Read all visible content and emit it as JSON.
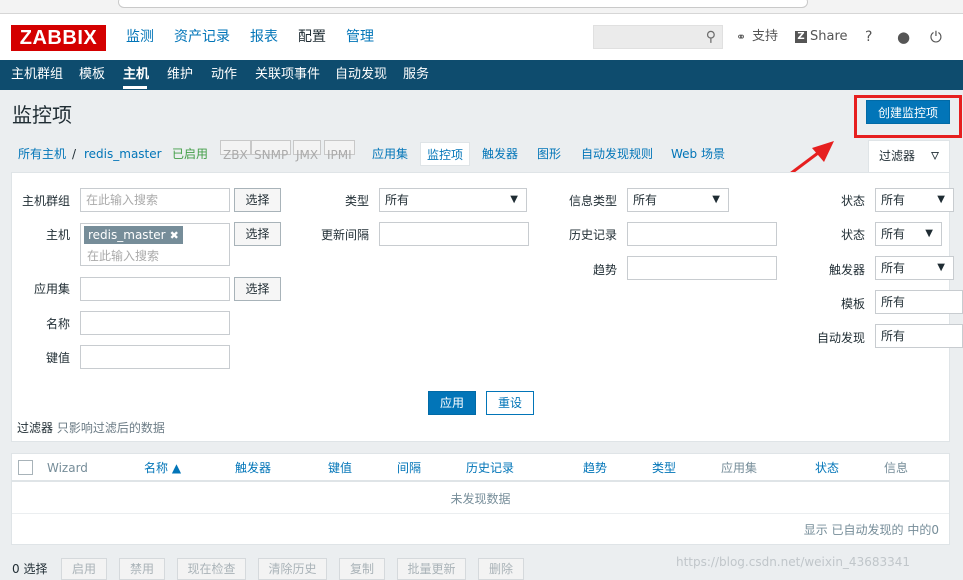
{
  "header": {
    "logo": "ZABBIX",
    "menu": [
      {
        "label": "监测",
        "active": false
      },
      {
        "label": "资产记录",
        "active": false
      },
      {
        "label": "报表",
        "active": false
      },
      {
        "label": "配置",
        "active": true
      },
      {
        "label": "管理",
        "active": false
      }
    ],
    "search_icon": "search-icon",
    "support_label": "支持",
    "share_label": "Share",
    "help_label": "?"
  },
  "subnav": {
    "items": [
      "主机群组",
      "模板",
      "主机",
      "维护",
      "动作",
      "关联项事件",
      "自动发现",
      "服务"
    ],
    "active": "主机"
  },
  "page": {
    "title": "监控项",
    "create_button": "创建监控项"
  },
  "breadcrumbs": {
    "all_hosts": "所有主机",
    "separator": "/",
    "host": "redis_master",
    "status": "已启用",
    "tags": [
      "ZBX",
      "SNMP",
      "JMX",
      "IPMI"
    ],
    "links": [
      "应用集",
      "监控项",
      "触发器",
      "图形",
      "自动发现规则",
      "Web 场景"
    ],
    "current": "监控项"
  },
  "filter": {
    "tab_label": "过滤器",
    "host_group_label": "主机群组",
    "host_group_placeholder": "在此输入搜索",
    "select_label": "选择",
    "host_label": "主机",
    "host_chip": "redis_master",
    "host_placeholder": "在此输入搜索",
    "application_label": "应用集",
    "name_label": "名称",
    "key_label": "键值",
    "type_label": "类型",
    "type_value": "所有",
    "interval_label": "更新间隔",
    "info_type_label": "信息类型",
    "info_type_value": "所有",
    "history_label": "历史记录",
    "trend_label": "趋势",
    "state_label": "状态",
    "state_value": "所有",
    "status_label": "状态",
    "status_value": "所有",
    "triggers_label": "触发器",
    "triggers_value": "所有",
    "template_label": "模板",
    "template_value": "所有",
    "discovery_label": "自动发现",
    "discovery_value": "所有",
    "apply_button": "应用",
    "reset_button": "重设",
    "note_title": "过滤器",
    "note_text": "只影响过滤后的数据"
  },
  "table": {
    "columns": [
      "Wizard",
      "名称 ▲",
      "触发器",
      "键值",
      "间隔",
      "历史记录",
      "趋势",
      "类型",
      "应用集",
      "状态",
      "信息"
    ],
    "empty_text": "未发现数据",
    "footer": "显示 已自动发现的 中的0"
  },
  "bottom": {
    "selected": "0 选择",
    "buttons": [
      "启用",
      "禁用",
      "现在检查",
      "清除历史",
      "复制",
      "批量更新",
      "删除"
    ]
  },
  "watermark": "https://blog.csdn.net/weixin_43683341",
  "colors": {
    "accent": "#0275b8",
    "nav": "#0e4c6e",
    "logo": "#d40000",
    "annotation": "#e61f1f",
    "enabled": "#429e47"
  }
}
